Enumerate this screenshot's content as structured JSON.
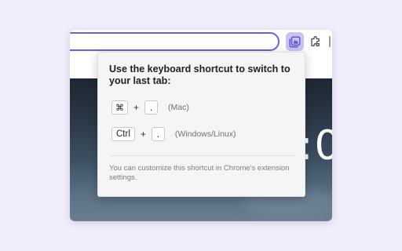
{
  "clock": {
    "visible_fragment": ":0"
  },
  "toolbar": {
    "extension_icon": "last-tab-extension-icon",
    "extensions_icon": "puzzle-icon",
    "accent_color": "#6a5ee4",
    "extension_active_bg": "#c9c3f2"
  },
  "popup": {
    "title": "Use the keyboard shortcut to switch to your last tab:",
    "shortcuts": [
      {
        "keys": [
          "⌘",
          "."
        ],
        "separator": "+",
        "platform": "(Mac)"
      },
      {
        "keys": [
          "Ctrl",
          "."
        ],
        "separator": "+",
        "platform": "(Windows/Linux)"
      }
    ],
    "note": "You can customize this shortcut in Chrome's extension settings."
  }
}
